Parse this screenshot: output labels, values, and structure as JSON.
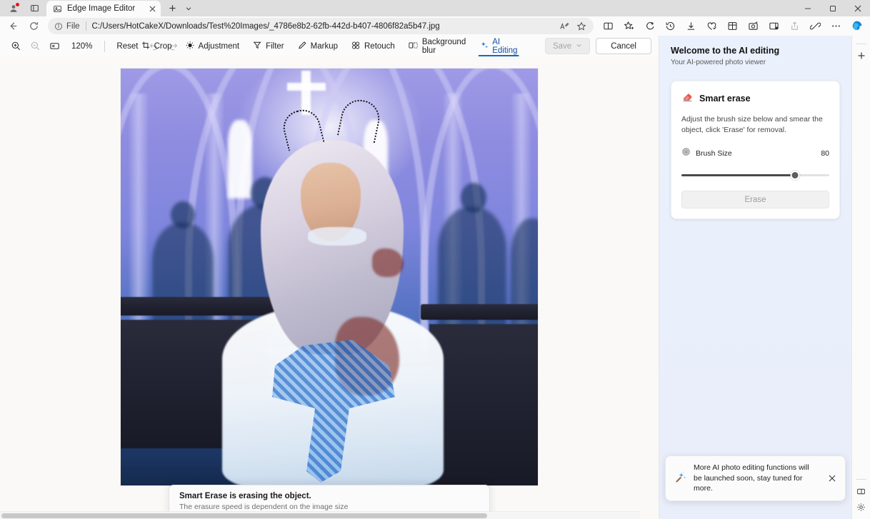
{
  "browser": {
    "tab": {
      "title": "Edge Image Editor",
      "favicon_icon": "image-editor-icon",
      "close_icon": "close-icon"
    },
    "new_tab_icon": "plus-icon",
    "tab_list_icon": "chevron-down-icon",
    "profile_icon": "profile-avatar-icon",
    "workspaces_icon": "workspaces-icon",
    "window_controls": {
      "minimize": "–",
      "maximize": "❐",
      "close": "✕"
    },
    "nav": {
      "back_icon": "back-arrow-icon",
      "refresh_icon": "refresh-icon",
      "info_icon": "info-circle-icon",
      "scheme_label": "File",
      "url": "C:/Users/HotCakeX/Downloads/Test%20Images/_4786e8b2-62fb-442d-b407-4806f82a5b47.jpg",
      "read_aloud_icon": "read-aloud-icon",
      "favorite_icon": "star-icon"
    },
    "toolbelt": [
      {
        "name": "split-screen-icon"
      },
      {
        "name": "favorites-icon"
      },
      {
        "name": "collections-icon"
      },
      {
        "name": "history-icon"
      },
      {
        "name": "downloads-icon"
      },
      {
        "name": "browser-essentials-icon"
      },
      {
        "name": "extensions-grid-icon"
      },
      {
        "name": "screenshot-icon"
      },
      {
        "name": "sidebar-icon"
      },
      {
        "name": "share-icon"
      },
      {
        "name": "copilot-link-icon"
      },
      {
        "name": "settings-more-icon"
      },
      {
        "name": "copilot-icon"
      }
    ]
  },
  "editor": {
    "zoom_in_icon": "zoom-in-icon",
    "zoom_out_icon": "zoom-out-icon",
    "fit_screen_icon": "fit-to-screen-icon",
    "zoom_level": "120%",
    "reset_label": "Reset",
    "undo_icon": "undo-icon",
    "redo_icon": "redo-icon",
    "tabs": [
      {
        "label": "Crop",
        "icon": "crop-icon",
        "active": false
      },
      {
        "label": "Adjustment",
        "icon": "brightness-icon",
        "active": false
      },
      {
        "label": "Filter",
        "icon": "filter-icon",
        "active": false
      },
      {
        "label": "Markup",
        "icon": "pen-icon",
        "active": false
      },
      {
        "label": "Retouch",
        "icon": "retouch-icon",
        "active": false
      },
      {
        "label": "Background blur",
        "icon": "background-blur-icon",
        "active": false
      },
      {
        "label": "AI Editing",
        "icon": "sparkle-icon",
        "active": true
      }
    ],
    "save_label": "Save",
    "save_chevron_icon": "chevron-down-icon",
    "save_enabled": false,
    "cancel_label": "Cancel"
  },
  "ai_panel": {
    "title": "Welcome to the AI editing",
    "subtitle": "Your AI-powered photo viewer",
    "card": {
      "icon": "eraser-icon",
      "title": "Smart erase",
      "description": "Adjust the brush size below and smear the object, click 'Erase' for removal.",
      "brush_icon": "brush-size-icon",
      "brush_label": "Brush Size",
      "brush_value": "80",
      "brush_percent": 77,
      "erase_label": "Erase"
    }
  },
  "toasts": {
    "progress": {
      "title": "Smart Erase is erasing the object.",
      "subtitle": "The erasure speed is dependent on the image size"
    },
    "announcement": {
      "icon": "sparkle-burst-icon",
      "text": "More AI photo editing functions will be launched soon, stay tuned for more.",
      "close_icon": "close-icon"
    }
  },
  "rail": {
    "add_icon": "plus-icon",
    "split_icon": "split-pane-icon",
    "settings_icon": "gear-icon"
  },
  "colors": {
    "accent": "#0f6cbd",
    "erase_mask": "#1f69c8",
    "eraser_red": "#e4574e",
    "badge_red": "#e81123"
  }
}
